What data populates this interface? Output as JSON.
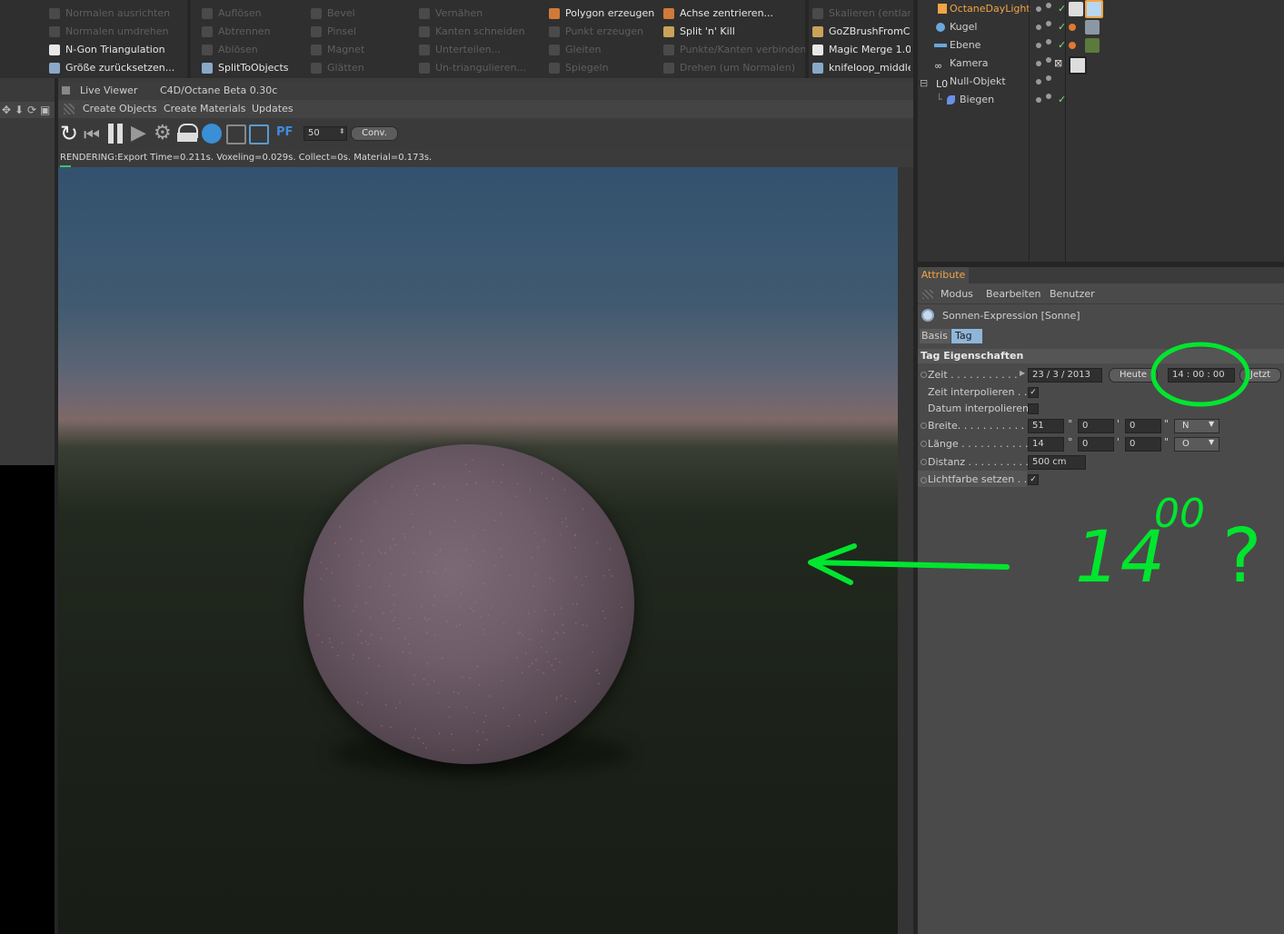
{
  "commands": {
    "col1": [
      {
        "label": "Normalen ausrichten",
        "enabled": false
      },
      {
        "label": "Normalen umdrehen",
        "enabled": false
      },
      {
        "label": "N-Gon Triangulation",
        "enabled": true
      },
      {
        "label": "Größe zurücksetzen...",
        "enabled": true
      }
    ],
    "col2": [
      {
        "label": "Auflösen",
        "enabled": false
      },
      {
        "label": "Abtrennen",
        "enabled": false
      },
      {
        "label": "Ablösen",
        "enabled": false
      },
      {
        "label": "SplitToObjects",
        "enabled": true
      }
    ],
    "col3": [
      {
        "label": "Bevel",
        "enabled": false
      },
      {
        "label": "Pinsel",
        "enabled": false
      },
      {
        "label": "Magnet",
        "enabled": false
      },
      {
        "label": "Glätten",
        "enabled": false
      }
    ],
    "col4": [
      {
        "label": "Vernähen",
        "enabled": false
      },
      {
        "label": "Kanten schneiden",
        "enabled": false
      },
      {
        "label": "Unterteilen...",
        "enabled": false
      },
      {
        "label": "Un-triangulieren...",
        "enabled": false
      }
    ],
    "col5": [
      {
        "label": "Polygon erzeugen",
        "enabled": true
      },
      {
        "label": "Punkt erzeugen",
        "enabled": false
      },
      {
        "label": "Gleiten",
        "enabled": false
      },
      {
        "label": "Spiegeln",
        "enabled": false
      }
    ],
    "col6": [
      {
        "label": "Achse zentrieren...",
        "enabled": true
      },
      {
        "label": "Split 'n' Kill",
        "enabled": true
      },
      {
        "label": "Punkte/Kanten verbinden",
        "enabled": false
      },
      {
        "label": "Drehen (um Normalen)",
        "enabled": false
      }
    ],
    "col7": [
      {
        "label": "Skalieren (entlan",
        "enabled": false
      },
      {
        "label": "GoZBrushFromCi",
        "enabled": true
      },
      {
        "label": "Magic Merge 1.0",
        "enabled": true
      },
      {
        "label": "knifeloop_middle",
        "enabled": true
      }
    ]
  },
  "live_viewer": {
    "title": "Live Viewer",
    "version": "C4D/Octane Beta 0.30c",
    "menu": [
      "Create Objects",
      "Create Materials",
      "Updates"
    ],
    "samples_value": "50",
    "conv_button": "Conv.",
    "pf_label": "PF",
    "status": "RENDERING:Export Time=0.211s.  Voxeling=0.029s.  Collect=0s. Material=0.173s."
  },
  "objects": [
    {
      "name": "OctaneDayLight",
      "highlight": true,
      "indent": 0
    },
    {
      "name": "Kugel",
      "highlight": false,
      "indent": 0
    },
    {
      "name": "Ebene",
      "highlight": false,
      "indent": 0
    },
    {
      "name": "Kamera",
      "highlight": false,
      "indent": 0
    },
    {
      "name": "Null-Objekt",
      "highlight": false,
      "indent": 0
    },
    {
      "name": "Biegen",
      "highlight": false,
      "indent": 1
    }
  ],
  "attributes": {
    "tab": "Attribute",
    "menu": [
      "Modus",
      "Bearbeiten",
      "Benutzer"
    ],
    "object_title": "Sonnen-Expression [Sonne]",
    "subtabs": [
      "Basis",
      "Tag"
    ],
    "section": "Tag Eigenschaften",
    "zeit_label": "Zeit . . . . . . . . . . .",
    "zeit_date": "23 / 3 / 2013",
    "heute_button": "Heute",
    "zeit_time": "14 : 00 : 00",
    "jetzt_button": "Jetzt",
    "zeit_interp_label": "Zeit interpolieren . . .",
    "zeit_interp_checked": "✓",
    "datum_interp_label": "Datum interpolieren",
    "breite_label": "Breite. . . . . . . . . . . . . .",
    "breite_values": [
      "51",
      "0",
      "0"
    ],
    "breite_dir": "N",
    "laenge_label": "Länge . . . . . . . . . . . . .",
    "laenge_values": [
      "14",
      "0",
      "0"
    ],
    "laenge_dir": "O",
    "distanz_label": "Distanz . . . . . . . . . . .",
    "distanz_value": "500 cm",
    "lichtfarbe_label": "Lichtfarbe setzen . . .",
    "lichtfarbe_checked": "✓",
    "degree": "°",
    "minute": "'",
    "second": "\""
  },
  "annotation": {
    "text_main": "14",
    "text_super": "00",
    "text_q": "?",
    "color": "#00e62e"
  },
  "colors": {
    "accent_orange": "#f2a447",
    "tag_tab_active": "#8fb6d9",
    "highlight_green": "#00e62e"
  }
}
